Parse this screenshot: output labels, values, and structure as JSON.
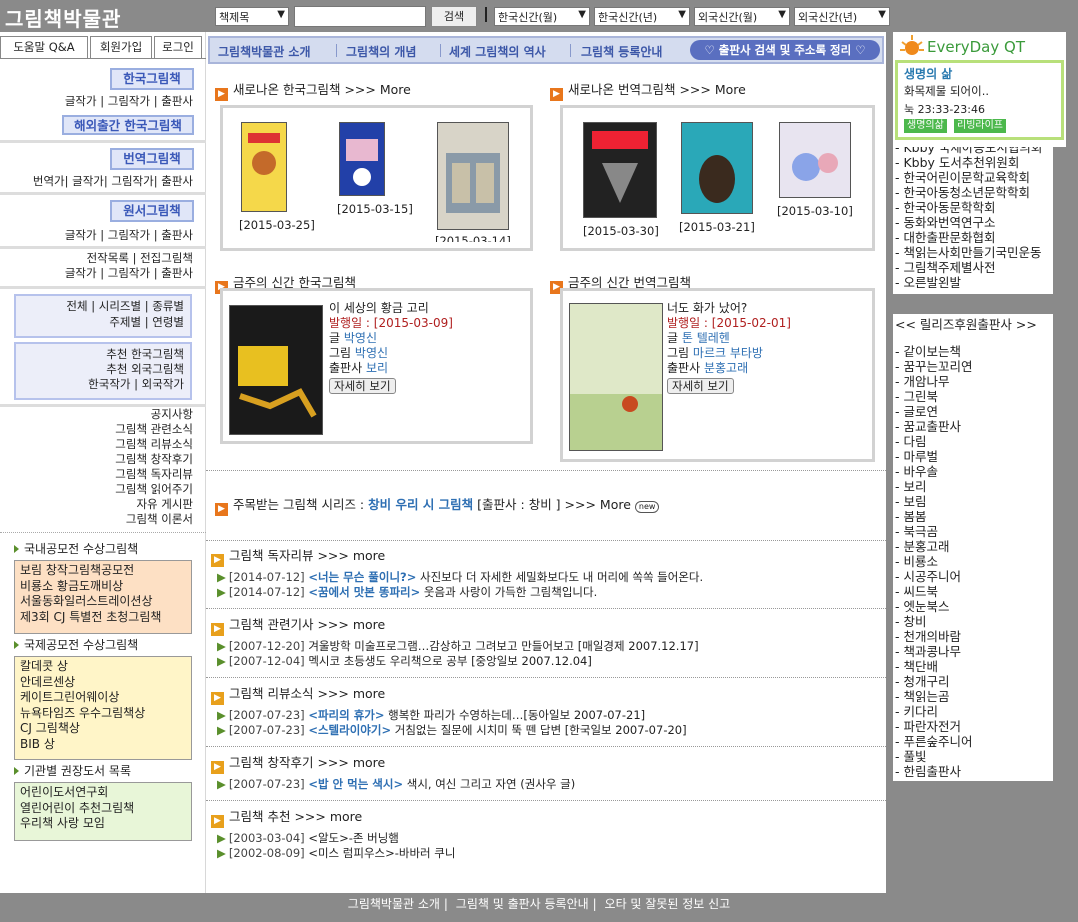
{
  "header": {
    "logo": "그림책박물관",
    "search_select": "책제목",
    "search_button": "검색",
    "dropdowns": [
      "한국신간(월)",
      "한국신간(년)",
      "외국신간(월)",
      "외국신간(년)"
    ]
  },
  "left_tabs": [
    "도움말 Q&A",
    "회원가입",
    "로그인"
  ],
  "left": {
    "korean_title": "한국그림책",
    "korean_links": "글작가 | 그림작가 | 출판사",
    "overseas_title": "해외출간 한국그림책",
    "trans_title": "번역그림책",
    "trans_links": "번역가| 글작가| 그림작가| 출판사",
    "orig_title": "원서그림책",
    "orig_links": "글작가 | 그림작가 | 출판사",
    "list1": "전작목록 | 전집그림책",
    "list2": "글작가 | 그림작가 | 출판사",
    "box1_row1": "전체 | 시리즈별 | 종류별",
    "box1_row2": "주제별 | 연령별",
    "box2_row1": "추천 한국그림책",
    "box2_row2": "추천 외국그림책",
    "box2_row3": "한국작가 | 외국작가",
    "menu": [
      "공지사항",
      "그림책 관련소식",
      "그림책 리뷰소식",
      "그림책 창작후기",
      "그림책 독자리뷰",
      "그림책 읽어주기",
      "자유 게시판",
      "그림책 이론서"
    ],
    "domestic_title": "국내공모전 수상그림책",
    "domestic_items": [
      "보림 창작그림책공모전",
      "비룡소 황금도깨비상",
      "서울동화일러스트레이션상",
      "제3회 CJ 특별전 초청그림책"
    ],
    "intl_title": "국제공모전 수상그림책",
    "intl_items": [
      "칼데콧 상",
      "안데르센상",
      "케이트그린어웨이상",
      "뉴욕타임즈 우수그림책상",
      "CJ 그림책상",
      "BIB 상"
    ],
    "org_title": "기관별 권장도서 목록",
    "org_items": [
      "어린이도서연구회",
      "열린어린이 추천그림책",
      "우리책 사랑 모임"
    ]
  },
  "topnav": {
    "items": [
      "그림책박물관 소개",
      "그림책의 개념",
      "세계 그림책의 역사",
      "그림책 등록안내"
    ],
    "pill": "♡ 출판사 검색 및 주소록 정리 ♡"
  },
  "new_korean": {
    "title": "새로나온 한국그림책 >>> More",
    "dates": [
      "[2015-03-25]",
      "[2015-03-15]",
      "[2015-03-14]"
    ]
  },
  "new_trans": {
    "title": "새로나온 번역그림책 >>> More",
    "dates": [
      "[2015-03-30]",
      "[2015-03-21]",
      "[2015-03-10]"
    ]
  },
  "week_korean": {
    "title": "금주의 신간 한국그림책",
    "book_title": "이 세상의 황금 고리",
    "pub_date": "발행일 : [2015-03-09]",
    "writer_label": "글",
    "writer": "박영신",
    "artist_label": "그림",
    "artist": "박영신",
    "publisher_label": "출판사",
    "publisher": "보리",
    "detail": "자세히 보기"
  },
  "week_trans": {
    "title": "금주의 신간 번역그림책",
    "book_title": "너도 화가 났어?",
    "pub_date": "발행일 : [2015-02-01]",
    "writer_label": "글",
    "writer": "톤 텔레헨",
    "artist_label": "그림",
    "artist": "마르크 부타방",
    "publisher_label": "출판사",
    "publisher": "분홍고래",
    "detail": "자세히 보기"
  },
  "series": {
    "prefix": "주목받는 그림책 시리즈 :",
    "name": "창비 우리 시 그림책",
    "suffix": "[출판사 : 창비 ] >>> More",
    "badge": "new"
  },
  "sections": [
    {
      "title": "그림책 독자리뷰 >>> more",
      "items": [
        {
          "date": "[2014-07-12]",
          "title": "<너는 무슨 풀이니?>",
          "text": "사진보다 더 자세한 세밀화보다도 내 머리에 쏙쏙 들어온다."
        },
        {
          "date": "[2014-07-12]",
          "title": "<꿈에서 맛본 똥파리>",
          "text": "웃음과 사랑이 가득한 그림책입니다."
        }
      ]
    },
    {
      "title": "그림책 관련기사 >>> more",
      "items": [
        {
          "date": "[2007-12-20]",
          "title": "",
          "text": "겨울방학 미술프로그램…감상하고 그려보고 만들어보고 [매일경제 2007.12.17]"
        },
        {
          "date": "[2007-12-04]",
          "title": "",
          "text": "멕시코 초등생도 우리책으로 공부 [중앙일보 2007.12.04]"
        }
      ]
    },
    {
      "title": "그림책 리뷰소식 >>> more",
      "items": [
        {
          "date": "[2007-07-23]",
          "title": "<파리의 휴가>",
          "text": "행복한 파리가 수영하는데…[동아일보 2007-07-21]"
        },
        {
          "date": "[2007-07-23]",
          "title": "<스텔라이야기>",
          "text": "거침없는 질문에 시치미 뚝 뗀 답변 [한국일보 2007-07-20]"
        }
      ]
    },
    {
      "title": "그림책 창작후기 >>> more",
      "items": [
        {
          "date": "[2007-07-23]",
          "title": "<밥 안 먹는 색시>",
          "text": "색시, 여신 그리고 자연 (권사우 글)"
        }
      ]
    },
    {
      "title": "그림책 추천 >>> more",
      "items": [
        {
          "date": "[2003-03-04]",
          "title": "",
          "text": "<알도>-존 버닝햄"
        },
        {
          "date": "[2002-08-09]",
          "title": "",
          "text": "<미스 럼피우스>-바바러 쿠니"
        }
      ]
    }
  ],
  "qt": {
    "brand": "EveryDay QT",
    "title": "생명의 삶",
    "line1": "화목제물 되어이..",
    "line2": "눅 23:33-23:46",
    "btn1": "생명의삶",
    "btn2": "리빙라이프"
  },
  "right_links": [
    "- Kbby 국제아동도서협의회",
    "- Kbby 도서추천위원회",
    "- 한국어린이문학교육학회",
    "- 한국아동청소년문학학회",
    "- 한국아동문학학회",
    "- 동화와번역연구소",
    "- 대한출판문화협회",
    "- 책읽는사회만들기국민운동",
    "- 그림책주제별사전",
    "- 오른발왼발"
  ],
  "sponsors_title": "<< 릴리즈후원출판사 >>",
  "sponsors": [
    "- 같이보는책",
    "- 꿈꾸는꼬리연",
    "- 개암나무",
    "- 그린북",
    "- 글로연",
    "- 꿈교출판사",
    "- 다림",
    "- 마루벌",
    "- 바우솔",
    "- 보리",
    "- 보림",
    "- 봄봄",
    "- 북극곰",
    "- 분홍고래",
    "- 비룡소",
    "- 시공주니어",
    "- 씨드북",
    "- 엣눈북스",
    "- 창비",
    "- 천개의바람",
    "- 책과콩나무",
    "- 책단배",
    "- 청개구리",
    "- 책읽는곰",
    "- 키다리",
    "- 파란자전거",
    "- 푸른숲주니어",
    "- 풀빛",
    "- 한림출판사"
  ],
  "footer": [
    "그림책박물관 소개",
    "그림책 및 출판사 등록안내",
    "오타 및 잘못된 정보 신고"
  ]
}
